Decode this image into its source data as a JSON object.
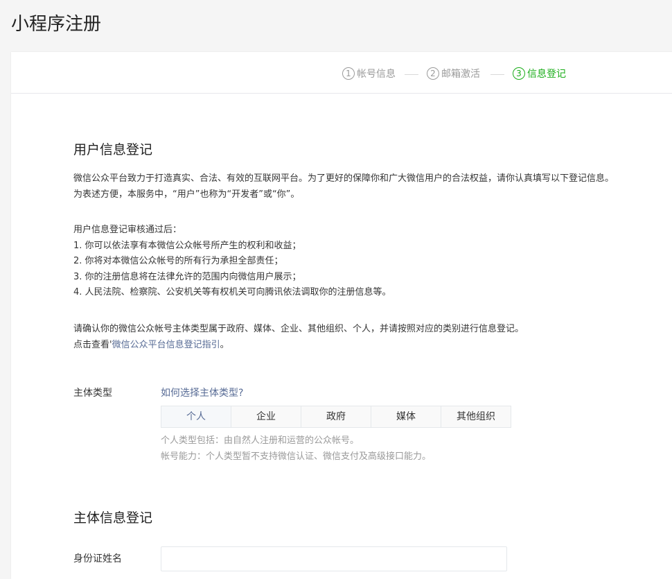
{
  "page_title": "小程序注册",
  "steps": [
    {
      "num": "1",
      "label": "帐号信息",
      "status": "done"
    },
    {
      "num": "2",
      "label": "邮箱激活",
      "status": "done"
    },
    {
      "num": "3",
      "label": "信息登记",
      "status": "active"
    }
  ],
  "user_info": {
    "title": "用户信息登记",
    "intro": [
      "微信公众平台致力于打造真实、合法、有效的互联网平台。为了更好的保障你和广大微信用户的合法权益，请你认真填写以下登记信息。",
      "为表述方便，本服务中，“用户”也称为“开发者”或“你”。"
    ],
    "after_review": [
      "用户信息登记审核通过后：",
      "1. 你可以依法享有本微信公众帐号所产生的权利和收益；",
      "2. 你将对本微信公众帐号的所有行为承担全部责任；",
      "3. 你的注册信息将在法律允许的范围内向微信用户展示；",
      "4. 人民法院、检察院、公安机关等有权机关可向腾讯依法调取你的注册信息等。"
    ],
    "confirm_line": "请确认你的微信公众帐号主体类型属于政府、媒体、企业、其他组织、个人，并请按照对应的类别进行信息登记。",
    "guide_prefix": "点击查看'",
    "guide_link": "微信公众平台信息登记指引",
    "guide_suffix": "。"
  },
  "subject_type": {
    "label": "主体类型",
    "help_link": "如何选择主体类型?",
    "options": [
      "个人",
      "企业",
      "政府",
      "媒体",
      "其他组织"
    ],
    "selected": "个人",
    "tips": [
      "个人类型包括：由自然人注册和运营的公众帐号。",
      "帐号能力：个人类型暂不支持微信认证、微信支付及高级接口能力。"
    ]
  },
  "subject_info": {
    "title": "主体信息登记",
    "id_name_label": "身份证姓名",
    "id_name_value": ""
  },
  "colors": {
    "accent_green": "#1aad19",
    "link_blue": "#576b95",
    "muted_gray": "#9a9a9a"
  }
}
